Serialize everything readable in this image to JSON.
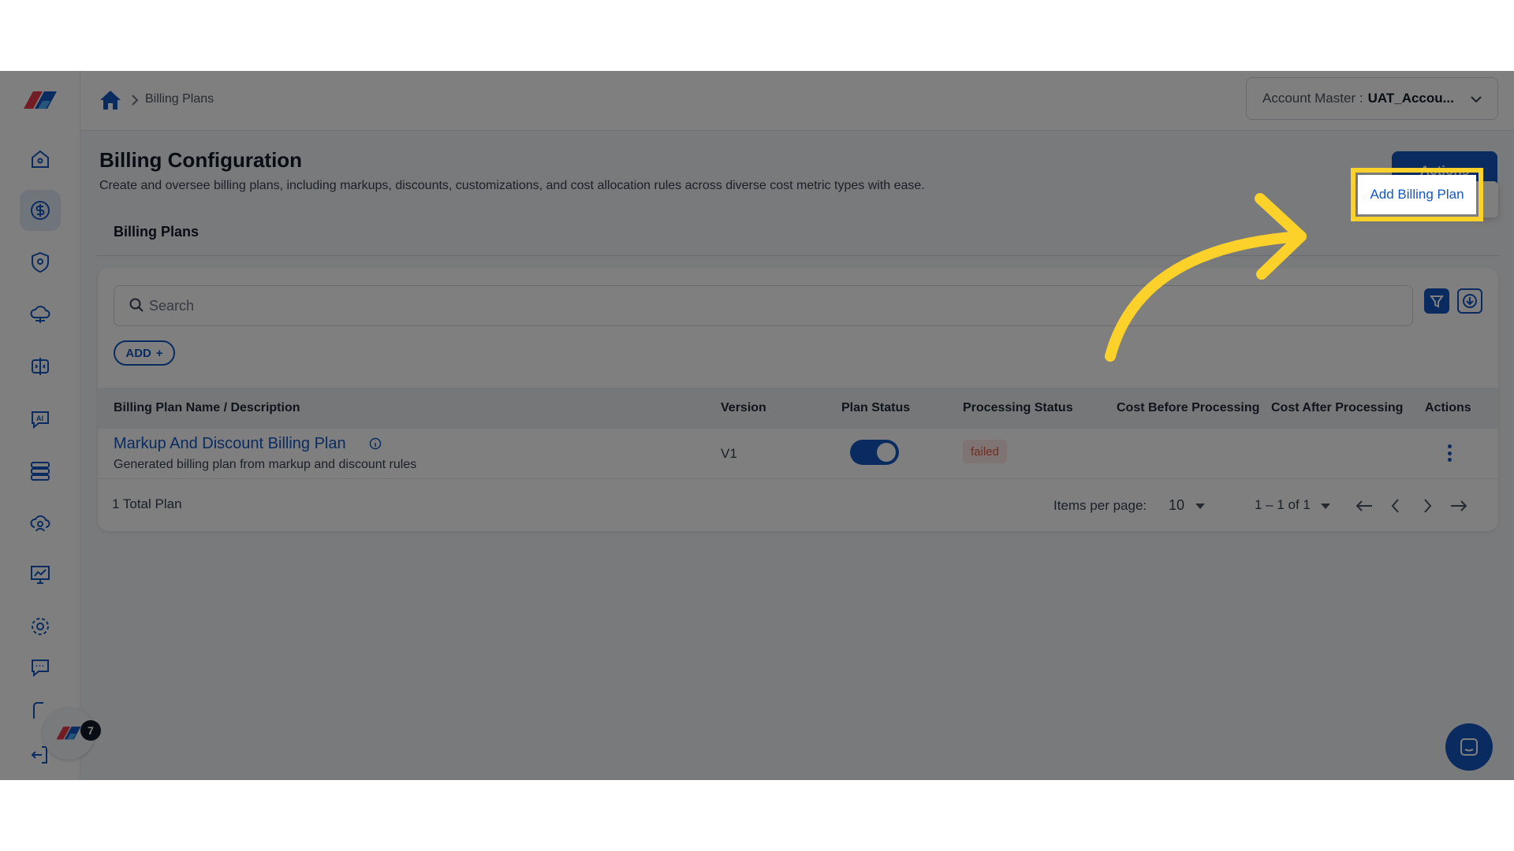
{
  "breadcrumb": {
    "current": "Billing Plans"
  },
  "account": {
    "label": "Account Master :",
    "value": "UAT_Accou..."
  },
  "header": {
    "title": "Billing Configuration",
    "description": "Create and oversee billing plans, including markups, discounts, customizations, and cost allocation rules across diverse cost metric types with ease.",
    "actions_label": "Actions"
  },
  "tabs": [
    {
      "label": "Billing Plans"
    }
  ],
  "search": {
    "placeholder": "Search"
  },
  "add_button": {
    "label": "ADD",
    "icon": "+"
  },
  "table": {
    "columns": [
      "Billing Plan Name / Description",
      "Version",
      "Plan Status",
      "Processing Status",
      "Cost Before Processing",
      "Cost After Processing",
      "Actions"
    ],
    "rows": [
      {
        "name": "Markup And Discount Billing Plan",
        "description": "Generated billing plan from markup and discount rules",
        "version": "V1",
        "plan_status": "on",
        "processing_status": "failed"
      }
    ]
  },
  "footer": {
    "total": "1 Total Plan",
    "items_per_page_label": "Items per page:",
    "items_per_page": "10",
    "range": "1 – 1 of 1"
  },
  "menu": {
    "add_billing_plan": "Add Billing Plan"
  },
  "notification_count": "7",
  "colors": {
    "primary": "#1557c0",
    "highlight": "#fcd12a",
    "failed": "#e4573d"
  },
  "icons": [
    "home-icon",
    "dollar-icon",
    "shield-icon",
    "cloud-icon",
    "compare-icon",
    "ai-chat-icon",
    "server-icon",
    "cloud-user-icon",
    "presentation-icon",
    "settings-icon",
    "feedback-icon",
    "support-icon",
    "logout-icon"
  ]
}
